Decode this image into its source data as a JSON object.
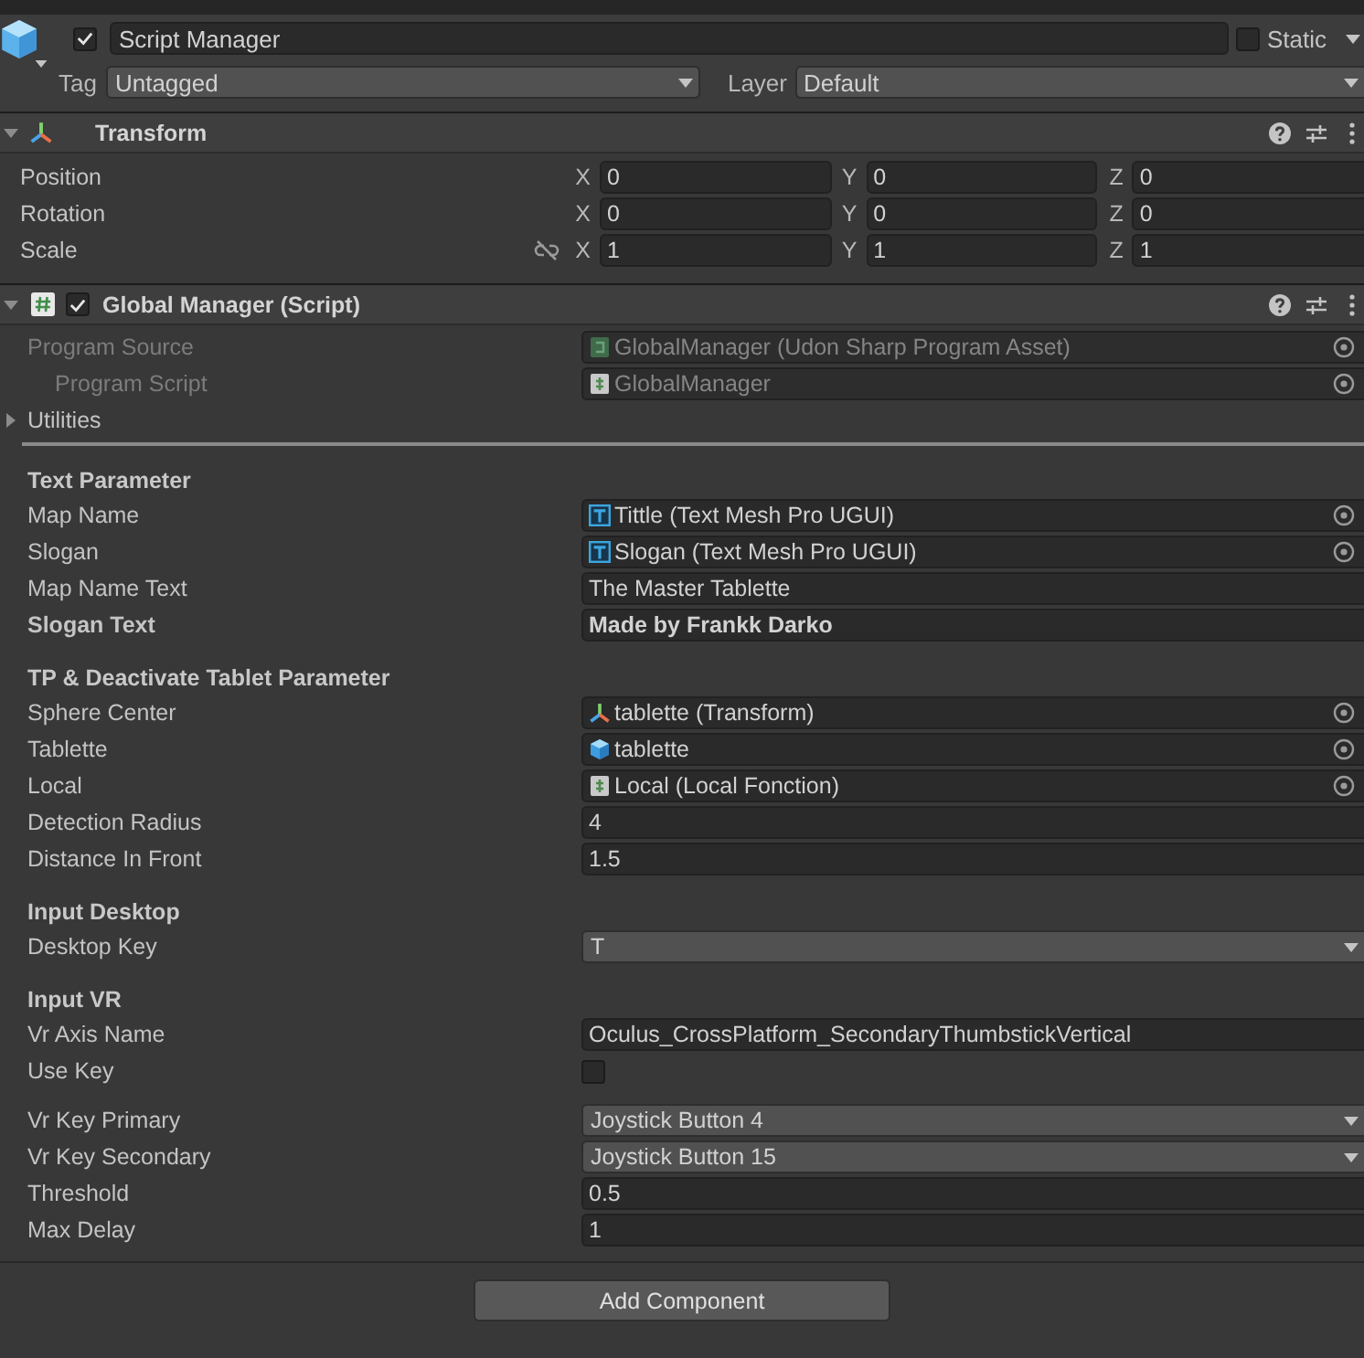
{
  "game_object": {
    "name": "Script Manager",
    "active": true,
    "static_label": "Static",
    "static": false,
    "tag_label": "Tag",
    "tag": "Untagged",
    "layer_label": "Layer",
    "layer": "Default"
  },
  "transform": {
    "title": "Transform",
    "expanded": true,
    "rows": [
      {
        "label": "Position",
        "kind": "vector",
        "values": [
          {
            "axis": "X",
            "value": "0"
          },
          {
            "axis": "Y",
            "value": "0"
          },
          {
            "axis": "Z",
            "value": "0"
          }
        ]
      },
      {
        "label": "Rotation",
        "kind": "vector",
        "values": [
          {
            "axis": "X",
            "value": "0"
          },
          {
            "axis": "Y",
            "value": "0"
          },
          {
            "axis": "Z",
            "value": "0"
          }
        ]
      },
      {
        "label": "Scale",
        "kind": "scale",
        "linked": false,
        "values": [
          {
            "axis": "X",
            "value": "1"
          },
          {
            "axis": "Y",
            "value": "1"
          },
          {
            "axis": "Z",
            "value": "1"
          }
        ]
      }
    ]
  },
  "script": {
    "title": "Global Manager (Script)",
    "expanded": true,
    "enabled": true,
    "program_fields": [
      {
        "label": "Program Source",
        "value": "GlobalManager (Udon Sharp Program Asset)",
        "kind": "asset_ref",
        "disabled": true,
        "children": [
          {
            "label": "Program Script",
            "value": "GlobalManager",
            "kind": "script_ref",
            "disabled": true
          }
        ]
      }
    ],
    "utilities": {
      "label": "Utilities",
      "expanded": false
    },
    "sections": [
      {
        "header": "Text Parameter",
        "fields": [
          {
            "label": "Map Name",
            "kind": "text_mesh_ref",
            "value": "Tittle (Text Mesh Pro UGUI)",
            "overridden": false
          },
          {
            "label": "Slogan",
            "kind": "text_mesh_ref",
            "value": "Slogan (Text Mesh Pro UGUI)",
            "overridden": false
          },
          {
            "label": "Map Name Text",
            "kind": "text",
            "value": "The Master Tablette",
            "overridden": false
          },
          {
            "label": "Slogan Text",
            "kind": "text",
            "value": "Made by Frankk Darko",
            "overridden": true
          }
        ]
      },
      {
        "header": "TP & Deactivate Tablet Parameter",
        "fields": [
          {
            "label": "Sphere Center",
            "kind": "transform_ref",
            "value": "tablette (Transform)",
            "overridden": false
          },
          {
            "label": "Tablette",
            "kind": "game_object_ref",
            "value": "tablette",
            "overridden": false
          },
          {
            "label": "Local",
            "kind": "script_ref",
            "value": "Local (Local Fonction)",
            "overridden": false
          },
          {
            "label": "Detection Radius",
            "kind": "text",
            "value": "4",
            "overridden": false
          },
          {
            "label": "Distance In Front",
            "kind": "text",
            "value": "1.5",
            "overridden": false
          }
        ]
      },
      {
        "header": "Input Desktop",
        "fields": [
          {
            "label": "Desktop Key",
            "kind": "dropdown",
            "value": "T",
            "overridden": false
          }
        ]
      },
      {
        "header": "Input VR",
        "fields": [
          {
            "label": "Vr Axis Name",
            "kind": "text",
            "value": "Oculus_CrossPlatform_SecondaryThumbstickVertical",
            "overridden": false
          },
          {
            "label": "Use Key",
            "kind": "checkbox",
            "checked": false,
            "overridden": false
          },
          {
            "label": "Vr Key Primary",
            "kind": "dropdown",
            "value": "Joystick Button 4",
            "overridden": false
          },
          {
            "label": "Vr Key Secondary",
            "kind": "dropdown",
            "value": "Joystick Button 15",
            "overridden": false
          },
          {
            "label": "Threshold",
            "kind": "text",
            "value": "0.5",
            "overridden": false
          },
          {
            "label": "Max Delay",
            "kind": "text",
            "value": "1",
            "overridden": false
          }
        ]
      }
    ]
  },
  "add_button": "Add Component"
}
